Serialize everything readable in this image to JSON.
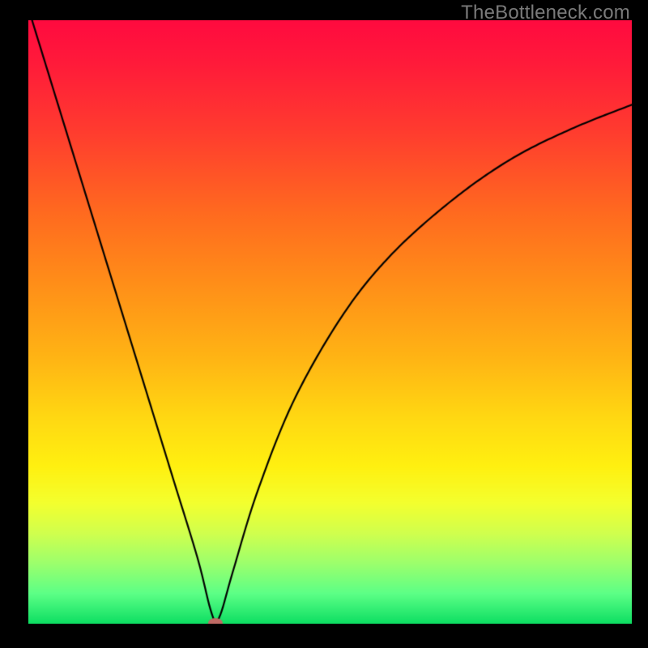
{
  "watermark": "TheBottleneck.com",
  "chart_data": {
    "type": "line",
    "title": "",
    "xlabel": "",
    "ylabel": "",
    "xlim": [
      0,
      100
    ],
    "ylim": [
      0,
      100
    ],
    "grid": false,
    "background_gradient": {
      "top_color": "#ff0a3f",
      "bottom_color": "#0dde62",
      "meaning": "red high bottleneck, green low bottleneck"
    },
    "series": [
      {
        "name": "bottleneck-curve",
        "color": "#000000",
        "x": [
          0,
          4,
          8,
          12,
          16,
          20,
          24,
          28,
          30,
          31,
          32,
          34,
          38,
          44,
          52,
          60,
          70,
          80,
          90,
          100
        ],
        "values": [
          102,
          89,
          76,
          63,
          50,
          37,
          24,
          11,
          3,
          0,
          2,
          9,
          22,
          37,
          51,
          61,
          70,
          77,
          82,
          86
        ]
      }
    ],
    "marker": {
      "name": "optimal-point",
      "x": 31,
      "y": 0,
      "color": "#bf6a64",
      "rx": 9,
      "ry": 6
    }
  }
}
